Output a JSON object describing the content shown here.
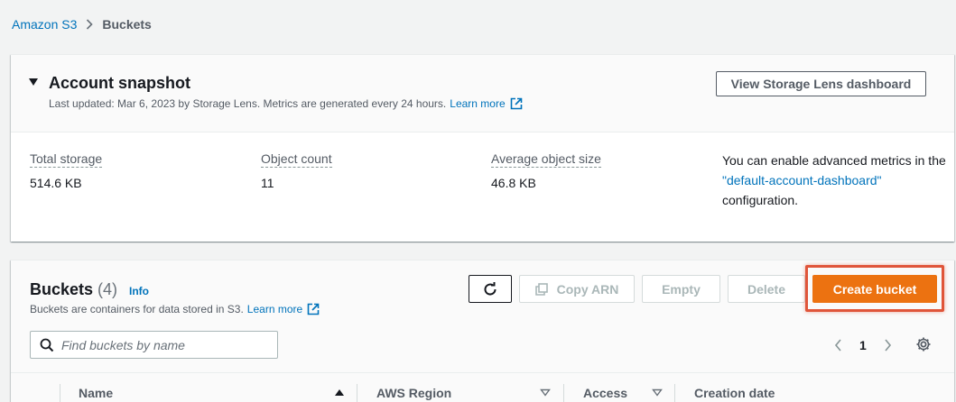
{
  "breadcrumb": {
    "root": "Amazon S3",
    "current": "Buckets"
  },
  "snapshot": {
    "title": "Account snapshot",
    "subtitle": "Last updated: Mar 6, 2023 by Storage Lens. Metrics are generated every 24 hours.",
    "learn_more": "Learn more",
    "lens_button": "View Storage Lens dashboard",
    "metrics": [
      {
        "label": "Total storage",
        "value": "514.6 KB"
      },
      {
        "label": "Object count",
        "value": "11"
      },
      {
        "label": "Average object size",
        "value": "46.8 KB"
      }
    ],
    "note_pre": "You can enable advanced metrics in the",
    "note_link": "\"default-account-dashboard\"",
    "note_post": "configuration."
  },
  "buckets": {
    "title": "Buckets",
    "count": "(4)",
    "info": "Info",
    "subtitle": "Buckets are containers for data stored in S3.",
    "learn_more": "Learn more",
    "buttons": {
      "copy_arn": "Copy ARN",
      "empty": "Empty",
      "delete": "Delete",
      "create": "Create bucket"
    },
    "search_placeholder": "Find buckets by name",
    "page": "1",
    "columns": [
      "Name",
      "AWS Region",
      "Access",
      "Creation date"
    ]
  },
  "colors": {
    "accent": "#ec7211",
    "link": "#0073bb",
    "highlight": "#e0553a"
  },
  "icons": [
    "chevron-right-icon",
    "caret-down-icon",
    "external-link-icon",
    "refresh-icon",
    "copy-icon",
    "search-icon",
    "chevron-left-icon",
    "settings-gear-icon",
    "sort-ascending-icon",
    "sort-caret-icon"
  ]
}
